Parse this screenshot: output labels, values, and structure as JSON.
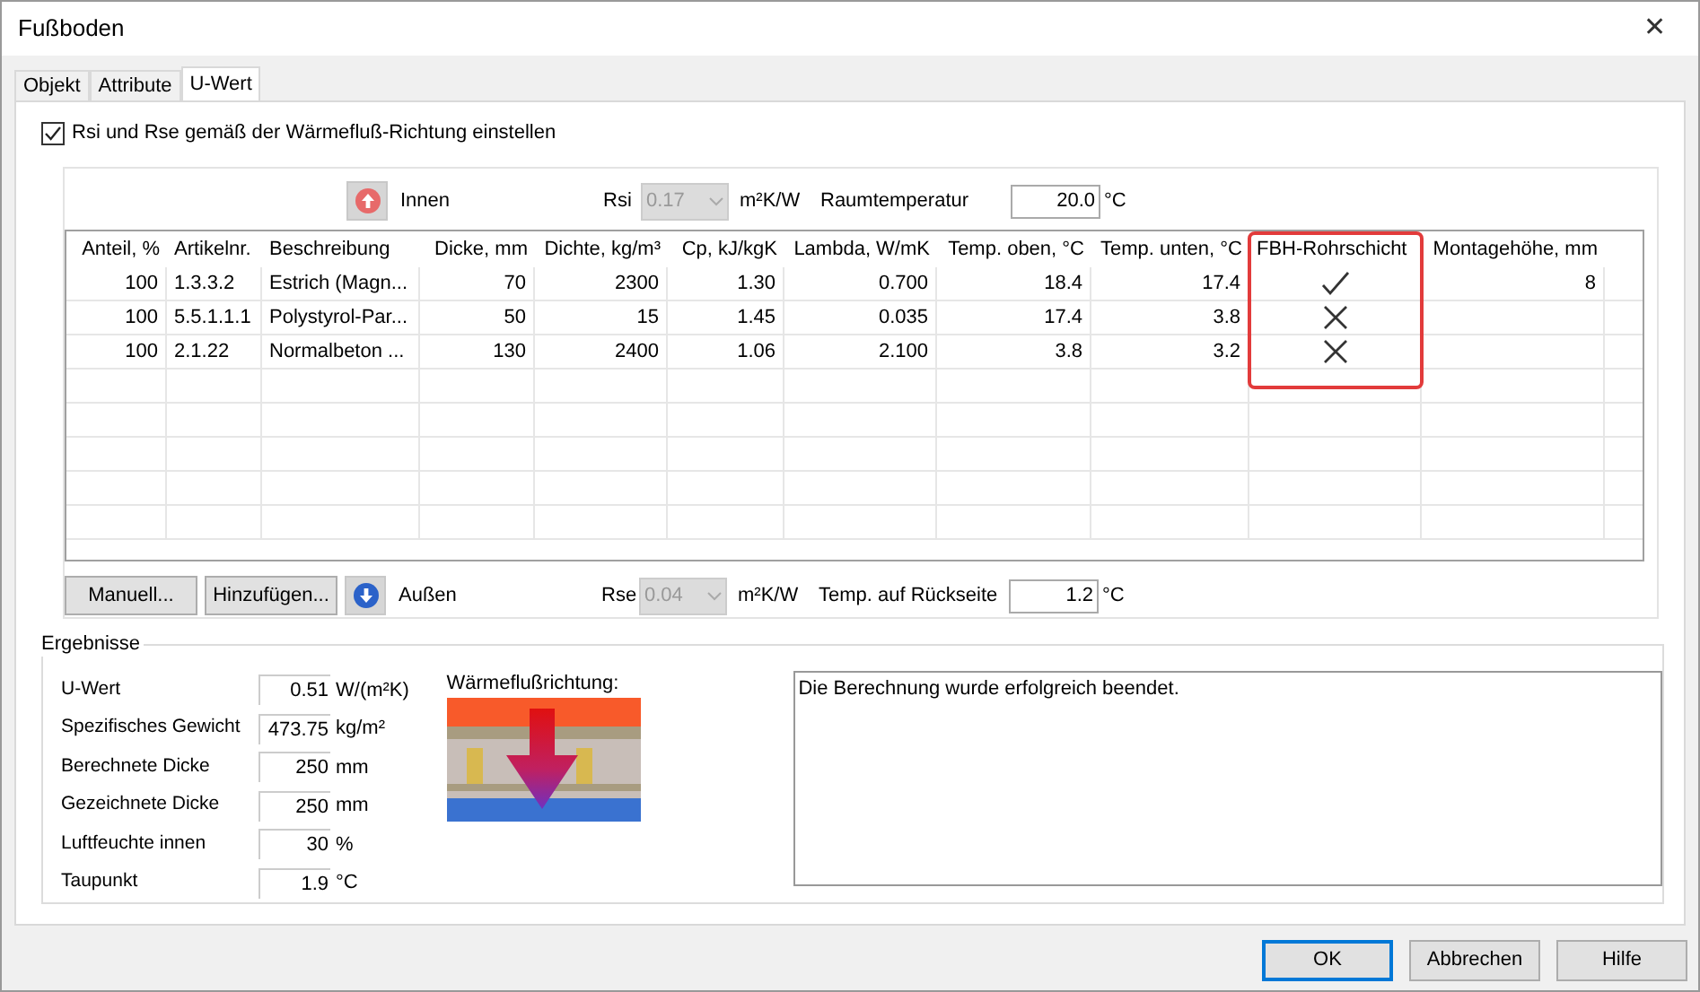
{
  "window": {
    "title": "Fußboden",
    "close": "✕"
  },
  "tabs": [
    {
      "label": "Objekt",
      "selected": false
    },
    {
      "label": "Attribute",
      "selected": false
    },
    {
      "label": "U-Wert",
      "selected": true
    }
  ],
  "rsi_checkbox": {
    "label": "Rsi und Rse gemäß der Wärmefluß-Richtung einstellen",
    "checked": true
  },
  "inside": {
    "label": "Innen",
    "rsi_label": "Rsi",
    "rsi_value": "0.17",
    "rsi_unit": "m²K/W",
    "temp_label": "Raumtemperatur",
    "temp_value": "20.0",
    "temp_unit": "°C"
  },
  "table": {
    "columns": [
      {
        "label": "Anteil, %",
        "highlighted": false
      },
      {
        "label": "Artikelnr.",
        "highlighted": false
      },
      {
        "label": "Beschreibung",
        "highlighted": false
      },
      {
        "label": "Dicke, mm",
        "highlighted": false
      },
      {
        "label": "Dichte, kg/m³",
        "highlighted": false
      },
      {
        "label": "Cp, kJ/kgK",
        "highlighted": false
      },
      {
        "label": "Lambda, W/mK",
        "highlighted": false
      },
      {
        "label": "Temp. oben, °C",
        "highlighted": false
      },
      {
        "label": "Temp. unten, °C",
        "highlighted": false
      },
      {
        "label": "FBH-Rohrschicht",
        "highlighted": true
      },
      {
        "label": "Montagehöhe, mm",
        "highlighted": false
      }
    ],
    "rows": [
      {
        "cells": [
          "100",
          "1.3.3.2",
          "Estrich (Magn...",
          "70",
          "2300",
          "1.30",
          "0.700",
          "18.4",
          "17.4"
        ],
        "fbh": true,
        "montagehoehe": "8"
      },
      {
        "cells": [
          "100",
          "5.5.1.1.1",
          "Polystyrol-Par...",
          "50",
          "15",
          "1.45",
          "0.035",
          "17.4",
          "3.8"
        ],
        "fbh": false
      },
      {
        "cells": [
          "100",
          "2.1.22",
          "Normalbeton ...",
          "130",
          "2400",
          "1.06",
          "2.100",
          "3.8",
          "3.2"
        ],
        "fbh": false
      }
    ]
  },
  "outside": {
    "buttons": [
      "Manuell...",
      "Hinzufügen..."
    ],
    "label": "Außen",
    "rse_label": "Rse",
    "rse_value": "0.04",
    "rse_unit": "m²K/W",
    "temp_label": "Temp. auf Rückseite",
    "temp_value": "1.2",
    "temp_unit": "°C"
  },
  "results": {
    "title": "Ergebnisse",
    "fields": [
      {
        "label": "U-Wert",
        "value": "0.51",
        "unit": "W/(m²K)"
      },
      {
        "label": "Spezifisches Gewicht",
        "value": "473.75",
        "unit": "kg/m²"
      },
      {
        "label": "Berechnete Dicke",
        "value": "250",
        "unit": "mm"
      },
      {
        "label": "Gezeichnete Dicke",
        "value": "250",
        "unit": "mm"
      },
      {
        "label": "Luftfeuchte innen",
        "value": "30",
        "unit": "%"
      },
      {
        "label": "Taupunkt",
        "value": "1.9",
        "unit": "°C"
      }
    ],
    "heat_flow_label": "Wärmeflußrichtung:",
    "message": "Die Berechnung wurde erfolgreich beendet."
  },
  "buttons": [
    "OK",
    "Abbrechen",
    "Hilfe"
  ]
}
